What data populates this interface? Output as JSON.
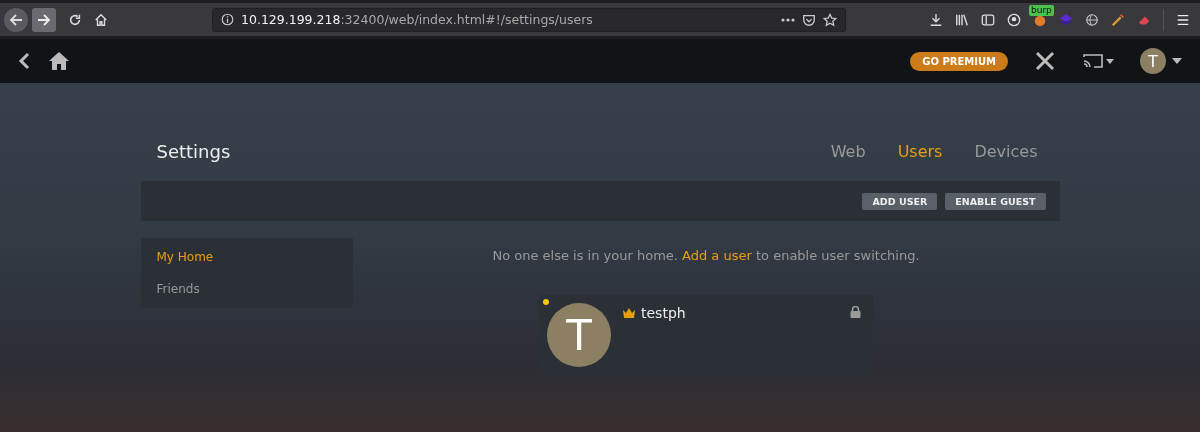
{
  "browser": {
    "url_host": "10.129.199.218",
    "url_path": ":32400/web/index.html#!/settings/users",
    "extension_badge": "burp"
  },
  "header": {
    "premium_button": "GO PREMIUM",
    "avatar_letter": "T"
  },
  "settings": {
    "title": "Settings",
    "tabs": [
      {
        "label": "Web",
        "selected": false
      },
      {
        "label": "Users",
        "selected": true
      },
      {
        "label": "Devices",
        "selected": false
      }
    ],
    "actions": [
      "ADD USER",
      "ENABLE GUEST"
    ],
    "sidebar": [
      {
        "label": "My Home",
        "selected": true
      },
      {
        "label": "Friends",
        "selected": false
      }
    ],
    "message": {
      "before": "No one else is in your home. ",
      "link": "Add a user",
      "after": " to enable user switching."
    },
    "users": [
      {
        "name": "testph",
        "initial": "T",
        "owner": true,
        "online": true
      }
    ]
  }
}
